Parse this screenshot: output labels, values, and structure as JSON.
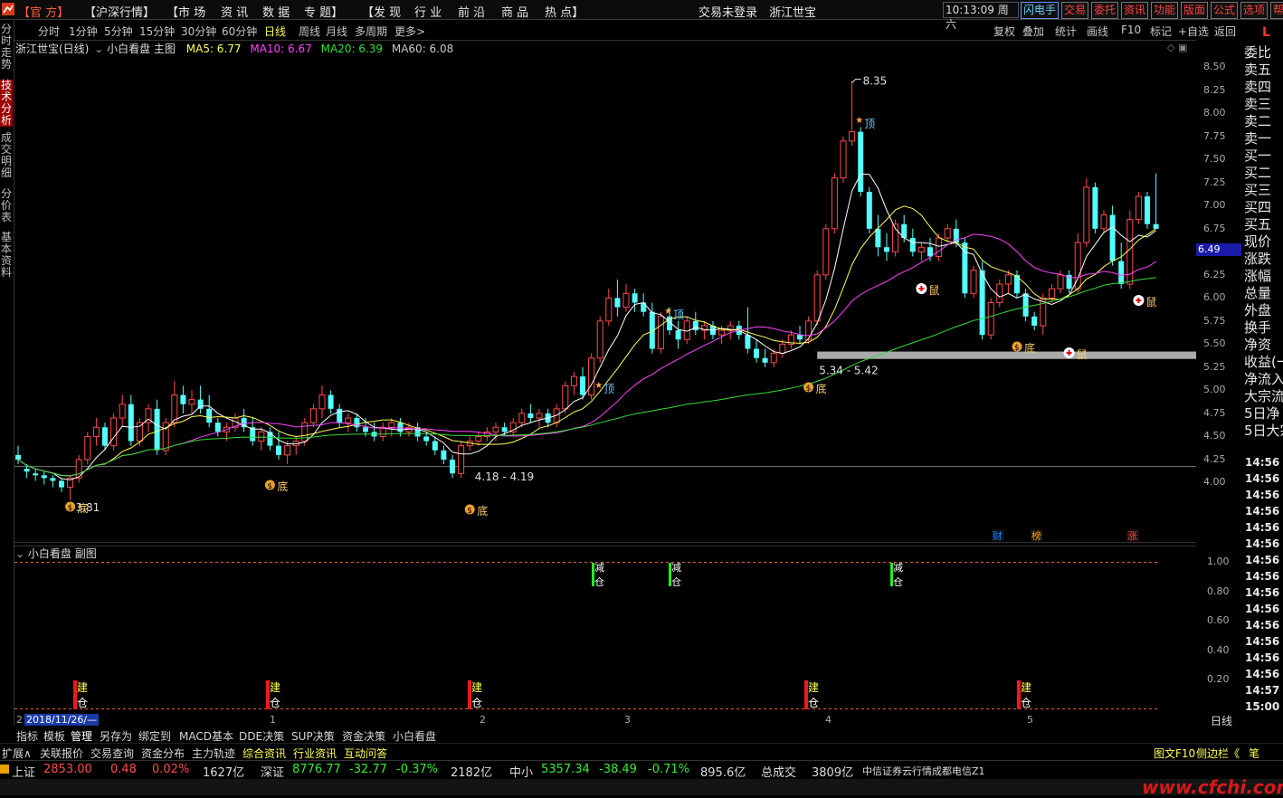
{
  "menubar": {
    "official": "【官 方】",
    "items": [
      "【沪深行情】",
      "【市 场",
      "资 讯",
      "数 据",
      "专 题】",
      "【发 现",
      "行 业",
      "前 沿",
      "商 品",
      "热 点】"
    ],
    "login_status": "交易未登录",
    "stock_name": "浙江世宝",
    "clock": "10:13:09",
    "weekday": "周六",
    "quick_buttons": [
      "闪电手",
      "交易",
      "委托",
      "资讯",
      "功能",
      "版面",
      "公式",
      "选项",
      "帮"
    ]
  },
  "sidebar": [
    "分时走势",
    "技术分析",
    "成交明细",
    "分价表",
    "基本资料"
  ],
  "periods": [
    "分时",
    "1分钟",
    "5分钟",
    "15分钟",
    "30分钟",
    "60分钟",
    "日线",
    "周线",
    "月线",
    "多周期",
    "更多>"
  ],
  "active_period": "日线",
  "chart_tools": [
    "复权",
    "叠加",
    "统计",
    "画线",
    "F10",
    "标记",
    "+自选",
    "返回"
  ],
  "info": {
    "title": "浙江世宝(日线)",
    "indicator": "小白看盘 主图",
    "ma5": "MA5: 6.77",
    "ma10": "MA10: 6.67",
    "ma20": "MA20: 6.39",
    "ma60": "MA60: 6.08"
  },
  "sub_chart": {
    "title": "小白看盘 副图",
    "y_ticks": [
      "1.00",
      "0.80",
      "0.60",
      "0.40",
      "0.20"
    ],
    "reduce": [
      "减",
      "仓"
    ],
    "build": [
      "建",
      "仓"
    ]
  },
  "x_axis": {
    "start_date": "2018/11/26/—",
    "ticks": [
      "1",
      "2",
      "3",
      "4",
      "5"
    ],
    "left_num": "2"
  },
  "right_panel": {
    "corner": "L",
    "current_price": "6.49",
    "y_ticks": [
      "8.50",
      "8.25",
      "8.00",
      "7.75",
      "7.50",
      "7.25",
      "7.00",
      "6.75",
      "6.50",
      "6.25",
      "6.00",
      "5.75",
      "5.50",
      "5.25",
      "5.00",
      "4.75",
      "4.50",
      "4.25",
      "4.00"
    ],
    "labels": [
      "委比",
      "卖五",
      "卖四",
      "卖三",
      "卖二",
      "卖一",
      "买一",
      "买二",
      "买三",
      "买四",
      "买五",
      "现价",
      "涨跌",
      "涨幅",
      "总量",
      "外盘",
      "换手",
      "净资",
      "收益(一",
      "净流入",
      "大宗流",
      "5日净",
      "5日大宗"
    ],
    "times": [
      "14:56",
      "14:56",
      "14:56",
      "14:56",
      "14:56",
      "14:56",
      "14:56",
      "14:56",
      "14:56",
      "14:56",
      "14:56",
      "14:56",
      "14:56",
      "14:56",
      "14:57",
      "15:00"
    ],
    "period_label": "日线"
  },
  "annotations": {
    "high": "8.35",
    "low": "3.81",
    "range1": "4.18 - 4.19",
    "range2": "5.34 - 5.42",
    "top": "顶",
    "bottom": "底",
    "rat": "鼠",
    "badges": [
      "财",
      "榜",
      "涨"
    ]
  },
  "toolbar1": [
    "指标",
    "模板",
    "管理",
    "另存为",
    "绑定到",
    "MACD基本",
    "DDE决策",
    "SUP决策",
    "资金决策",
    "小白看盘"
  ],
  "toolbar2": [
    "扩展∧",
    "关联报价",
    "交易查询",
    "资金分布",
    "主力轨迹",
    "综合资讯",
    "行业资讯",
    "互动问答"
  ],
  "toolbar2_right": [
    "图文F10",
    "侧边栏《",
    "笔"
  ],
  "status": {
    "sh_label": "上证",
    "sh_value": "2853.00",
    "sh_change": "0.48",
    "sh_pct": "0.02%",
    "sh_amount": "1627亿",
    "sz_label": "深证",
    "sz_value": "8776.77",
    "sz_change": "-32.77",
    "sz_pct": "-0.37%",
    "sz_amount": "2182亿",
    "zx_label": "中小",
    "zx_value": "5357.34",
    "zx_change": "-38.49",
    "zx_pct": "-0.71%",
    "zx_amount": "895.6亿",
    "total_label": "总成交",
    "total_value": "3809亿",
    "broker": "中信证券云行情成都电信Z1"
  },
  "watermark": "www.cfchi.com",
  "colors": {
    "up": "#ff4a4a",
    "down": "#54ffff",
    "ma5": "#ffffff",
    "ma10": "#ffff55",
    "ma20": "#ff44ff",
    "ma60": "#33dd33"
  },
  "chart_data": {
    "type": "candlestick",
    "ylim": [
      3.75,
      8.6
    ],
    "ohlc": [
      [
        4.3,
        4.4,
        4.2,
        4.25
      ],
      [
        4.15,
        4.2,
        4.05,
        4.12
      ],
      [
        4.1,
        4.15,
        4.02,
        4.08
      ],
      [
        4.08,
        4.12,
        3.98,
        4.05
      ],
      [
        4.05,
        4.08,
        3.95,
        4.02
      ],
      [
        4.02,
        4.05,
        3.9,
        3.95
      ],
      [
        3.95,
        4.08,
        3.81,
        4.05
      ],
      [
        4.05,
        4.3,
        4.0,
        4.25
      ],
      [
        4.25,
        4.55,
        4.2,
        4.5
      ],
      [
        4.5,
        4.7,
        4.4,
        4.6
      ],
      [
        4.6,
        4.65,
        4.35,
        4.4
      ],
      [
        4.4,
        4.75,
        4.35,
        4.7
      ],
      [
        4.7,
        4.95,
        4.6,
        4.85
      ],
      [
        4.85,
        4.95,
        4.4,
        4.45
      ],
      [
        4.45,
        4.7,
        4.4,
        4.65
      ],
      [
        4.65,
        4.85,
        4.55,
        4.8
      ],
      [
        4.8,
        4.9,
        4.3,
        4.35
      ],
      [
        4.35,
        4.7,
        4.3,
        4.65
      ],
      [
        4.65,
        5.1,
        4.6,
        4.95
      ],
      [
        4.95,
        5.05,
        4.75,
        4.85
      ],
      [
        4.85,
        5.0,
        4.75,
        4.9
      ],
      [
        4.9,
        5.05,
        4.75,
        4.8
      ],
      [
        4.8,
        4.95,
        4.6,
        4.65
      ],
      [
        4.65,
        4.7,
        4.5,
        4.55
      ],
      [
        4.55,
        4.65,
        4.45,
        4.6
      ],
      [
        4.6,
        4.75,
        4.55,
        4.7
      ],
      [
        4.7,
        4.8,
        4.55,
        4.6
      ],
      [
        4.6,
        4.7,
        4.4,
        4.45
      ],
      [
        4.45,
        4.6,
        4.35,
        4.55
      ],
      [
        4.55,
        4.6,
        4.35,
        4.4
      ],
      [
        4.4,
        4.55,
        4.25,
        4.3
      ],
      [
        4.3,
        4.45,
        4.2,
        4.4
      ],
      [
        4.4,
        4.5,
        4.3,
        4.45
      ],
      [
        4.45,
        4.7,
        4.4,
        4.65
      ],
      [
        4.65,
        4.85,
        4.6,
        4.8
      ],
      [
        4.8,
        5.05,
        4.7,
        4.95
      ],
      [
        4.95,
        5.0,
        4.75,
        4.8
      ],
      [
        4.8,
        4.85,
        4.6,
        4.65
      ],
      [
        4.65,
        4.75,
        4.55,
        4.7
      ],
      [
        4.7,
        4.75,
        4.55,
        4.6
      ],
      [
        4.6,
        4.7,
        4.5,
        4.55
      ],
      [
        4.55,
        4.65,
        4.45,
        4.5
      ],
      [
        4.5,
        4.65,
        4.45,
        4.6
      ],
      [
        4.6,
        4.7,
        4.5,
        4.65
      ],
      [
        4.65,
        4.7,
        4.5,
        4.55
      ],
      [
        4.55,
        4.65,
        4.5,
        4.6
      ],
      [
        4.6,
        4.65,
        4.45,
        4.5
      ],
      [
        4.5,
        4.55,
        4.4,
        4.45
      ],
      [
        4.45,
        4.5,
        4.3,
        4.35
      ],
      [
        4.35,
        4.4,
        4.2,
        4.25
      ],
      [
        4.25,
        4.3,
        4.05,
        4.1
      ],
      [
        4.1,
        4.45,
        4.05,
        4.4
      ],
      [
        4.4,
        4.5,
        4.35,
        4.45
      ],
      [
        4.45,
        4.55,
        4.4,
        4.5
      ],
      [
        4.5,
        4.6,
        4.45,
        4.55
      ],
      [
        4.55,
        4.65,
        4.45,
        4.6
      ],
      [
        4.6,
        4.65,
        4.5,
        4.55
      ],
      [
        4.55,
        4.7,
        4.5,
        4.65
      ],
      [
        4.65,
        4.8,
        4.6,
        4.75
      ],
      [
        4.75,
        4.85,
        4.65,
        4.7
      ],
      [
        4.7,
        4.8,
        4.6,
        4.75
      ],
      [
        4.75,
        4.8,
        4.6,
        4.65
      ],
      [
        4.65,
        4.85,
        4.6,
        4.8
      ],
      [
        4.8,
        5.1,
        4.75,
        5.05
      ],
      [
        5.05,
        5.2,
        4.95,
        5.15
      ],
      [
        5.15,
        5.25,
        4.9,
        4.95
      ],
      [
        4.95,
        5.4,
        4.9,
        5.35
      ],
      [
        5.35,
        5.8,
        5.3,
        5.75
      ],
      [
        5.75,
        6.1,
        5.7,
        6.0
      ],
      [
        6.0,
        6.2,
        5.8,
        5.9
      ],
      [
        5.9,
        6.15,
        5.85,
        6.05
      ],
      [
        6.05,
        6.1,
        5.85,
        5.95
      ],
      [
        5.95,
        6.05,
        5.8,
        5.85
      ],
      [
        5.85,
        5.95,
        5.4,
        5.45
      ],
      [
        5.45,
        5.85,
        5.4,
        5.8
      ],
      [
        5.8,
        5.9,
        5.6,
        5.65
      ],
      [
        5.65,
        5.75,
        5.45,
        5.55
      ],
      [
        5.55,
        5.8,
        5.5,
        5.75
      ],
      [
        5.75,
        5.85,
        5.6,
        5.65
      ],
      [
        5.65,
        5.75,
        5.55,
        5.7
      ],
      [
        5.7,
        5.75,
        5.55,
        5.6
      ],
      [
        5.6,
        5.7,
        5.5,
        5.65
      ],
      [
        5.65,
        5.75,
        5.55,
        5.7
      ],
      [
        5.7,
        5.75,
        5.55,
        5.6
      ],
      [
        5.6,
        5.9,
        5.4,
        5.45
      ],
      [
        5.45,
        5.55,
        5.3,
        5.35
      ],
      [
        5.35,
        5.45,
        5.25,
        5.3
      ],
      [
        5.3,
        5.45,
        5.25,
        5.4
      ],
      [
        5.4,
        5.55,
        5.35,
        5.5
      ],
      [
        5.5,
        5.65,
        5.45,
        5.6
      ],
      [
        5.6,
        5.7,
        5.5,
        5.55
      ],
      [
        5.55,
        5.8,
        5.5,
        5.75
      ],
      [
        5.75,
        6.3,
        5.7,
        6.25
      ],
      [
        6.25,
        6.8,
        6.2,
        6.75
      ],
      [
        6.75,
        7.35,
        6.7,
        7.3
      ],
      [
        7.3,
        7.75,
        7.25,
        7.7
      ],
      [
        7.7,
        8.35,
        7.65,
        7.8
      ],
      [
        7.8,
        7.85,
        7.1,
        7.15
      ],
      [
        7.15,
        7.2,
        6.7,
        6.75
      ],
      [
        6.75,
        6.9,
        6.45,
        6.55
      ],
      [
        6.55,
        6.7,
        6.4,
        6.5
      ],
      [
        6.5,
        6.85,
        6.45,
        6.8
      ],
      [
        6.8,
        6.9,
        6.6,
        6.65
      ],
      [
        6.65,
        6.75,
        6.45,
        6.5
      ],
      [
        6.5,
        6.6,
        6.4,
        6.55
      ],
      [
        6.55,
        6.65,
        6.4,
        6.45
      ],
      [
        6.45,
        6.7,
        6.4,
        6.65
      ],
      [
        6.65,
        6.8,
        6.6,
        6.75
      ],
      [
        6.75,
        6.85,
        6.55,
        6.6
      ],
      [
        6.6,
        6.65,
        6.0,
        6.05
      ],
      [
        6.05,
        6.35,
        6.0,
        6.3
      ],
      [
        6.3,
        6.4,
        5.55,
        5.6
      ],
      [
        5.6,
        6.0,
        5.55,
        5.95
      ],
      [
        5.95,
        6.2,
        5.9,
        6.15
      ],
      [
        6.15,
        6.3,
        6.05,
        6.25
      ],
      [
        6.25,
        6.3,
        6.0,
        6.05
      ],
      [
        6.05,
        6.1,
        5.75,
        5.8
      ],
      [
        5.8,
        5.85,
        5.65,
        5.7
      ],
      [
        5.7,
        6.05,
        5.6,
        6.0
      ],
      [
        6.0,
        6.15,
        5.95,
        6.1
      ],
      [
        6.1,
        6.3,
        6.05,
        6.25
      ],
      [
        6.25,
        6.3,
        6.05,
        6.1
      ],
      [
        6.1,
        6.7,
        6.05,
        6.6
      ],
      [
        6.6,
        7.3,
        6.55,
        7.2
      ],
      [
        7.2,
        7.25,
        6.7,
        6.75
      ],
      [
        6.75,
        6.95,
        6.7,
        6.9
      ],
      [
        6.9,
        7.0,
        6.35,
        6.4
      ],
      [
        6.4,
        6.6,
        6.1,
        6.15
      ],
      [
        6.15,
        6.95,
        6.1,
        6.85
      ],
      [
        6.85,
        7.15,
        6.8,
        7.1
      ],
      [
        7.1,
        7.15,
        6.75,
        6.8
      ],
      [
        6.8,
        7.35,
        6.75,
        6.75
      ]
    ]
  }
}
